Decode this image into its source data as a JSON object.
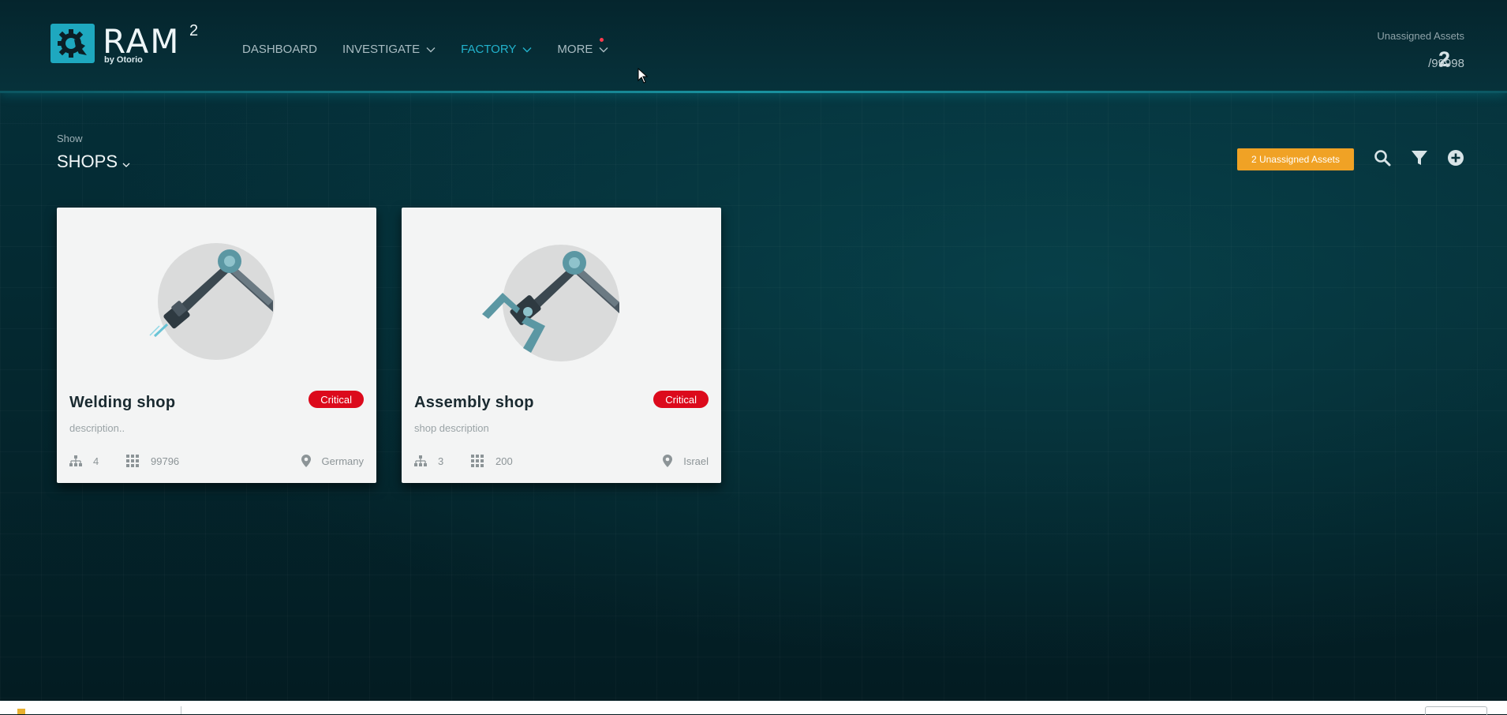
{
  "header": {
    "logo": {
      "name": "RAM",
      "superscript": "2",
      "byline": "by Otorio"
    },
    "nav": [
      {
        "label": "DASHBOARD",
        "has_dropdown": false,
        "active": false
      },
      {
        "label": "INVESTIGATE",
        "has_dropdown": true,
        "active": false
      },
      {
        "label": "FACTORY",
        "has_dropdown": true,
        "active": true
      },
      {
        "label": "MORE",
        "has_dropdown": true,
        "active": false,
        "notification_dot": true
      }
    ],
    "unassigned_assets": {
      "label": "Unassigned Assets",
      "count": "2",
      "total": "/99998"
    }
  },
  "toolbar": {
    "show_label": "Show",
    "show_value": "SHOPS",
    "unassigned_button": "2 Unassigned Assets",
    "icons": [
      "search-icon",
      "filter-icon",
      "add-circle-icon"
    ]
  },
  "cards": [
    {
      "title": "Welding shop",
      "badge": "Critical",
      "description": "description..",
      "lines": "4",
      "assets": "99796",
      "location": "Germany",
      "image": "welding-robot-arm"
    },
    {
      "title": "Assembly shop",
      "badge": "Critical",
      "description": "shop description",
      "lines": "3",
      "assets": "200",
      "location": "Israel",
      "image": "assembly-robot-arm"
    }
  ],
  "colors": {
    "accent": "#22b2cc",
    "critical": "#dc0a1c",
    "warning_button": "#f0a225",
    "background": "#042a32"
  }
}
